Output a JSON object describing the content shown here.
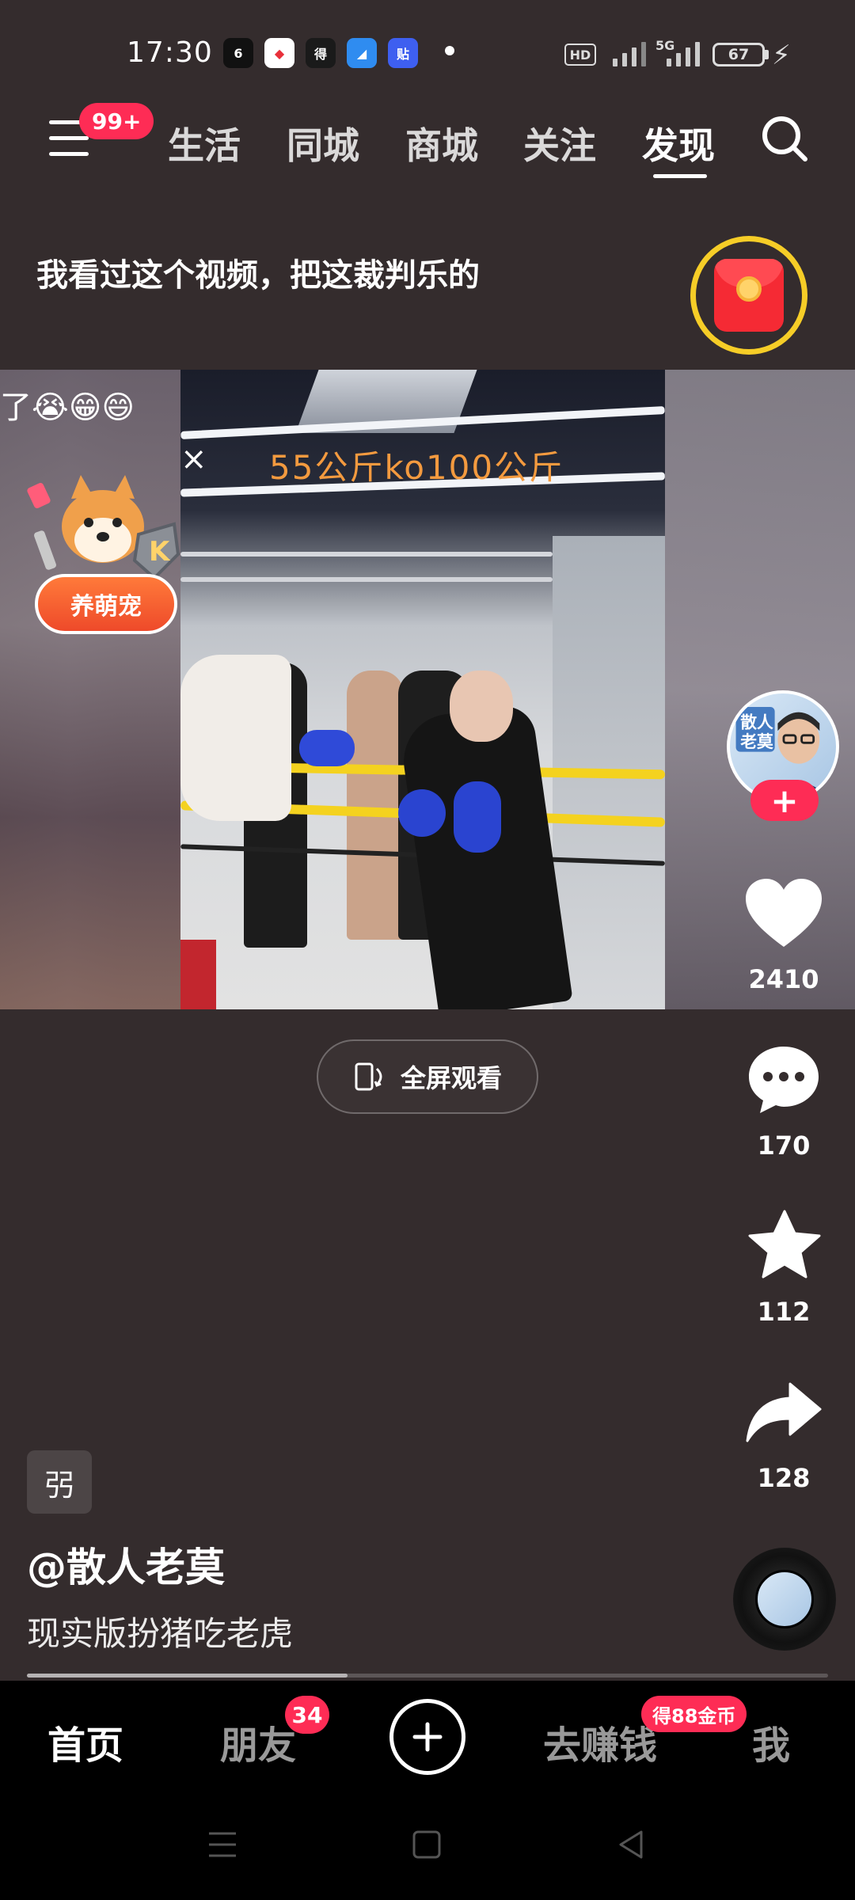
{
  "status_bar": {
    "time": "17:30",
    "app_icons": [
      {
        "name": "tiktok-app-icon",
        "label": "6",
        "bg": "#111111",
        "fg": "#ffffff"
      },
      {
        "name": "map-app-icon",
        "label": "◆",
        "bg": "#ffffff",
        "fg": "#e8303a"
      },
      {
        "name": "news-app-icon",
        "label": "得",
        "bg": "#1a1a1a",
        "fg": "#ffffff"
      },
      {
        "name": "browser-app-icon",
        "label": "◢",
        "bg": "#2f8cf0",
        "fg": "#ffffff"
      },
      {
        "name": "tieba-app-icon",
        "label": "贴",
        "bg": "#3e5ff0",
        "fg": "#ffffff"
      }
    ],
    "hd_label": "HD",
    "network": "5G",
    "battery": "67"
  },
  "top_nav": {
    "menu_badge": "99+",
    "tabs": [
      {
        "label": "生活",
        "active": false
      },
      {
        "label": "同城",
        "active": false
      },
      {
        "label": "商城",
        "active": false
      },
      {
        "label": "关注",
        "active": false
      },
      {
        "label": "发现",
        "active": true
      }
    ]
  },
  "comment_line": "我看过这个视频，把这裁判乐的",
  "video": {
    "overlay_text": "55公斤ko100公斤",
    "emoji_line": "了😭😁😄",
    "pet_button": "养萌宠"
  },
  "rail": {
    "likes": "2410",
    "comments": "170",
    "favorites": "112",
    "shares": "128"
  },
  "fullscreen_label": "全屏观看",
  "caption": {
    "tag": "弜",
    "author": "@散人老莫",
    "description": "现实版扮猪吃老虎",
    "progress": 0.4
  },
  "bottom_nav": {
    "home": "首页",
    "friends": "朋友",
    "friends_badge": "34",
    "earn": "去赚钱",
    "earn_badge": "得88金币",
    "me": "我"
  },
  "colors": {
    "background": "#342c2d",
    "accent": "#fe2c55",
    "overlay_text": "#f39a3f",
    "red_packet_ring": "#f6cd27"
  }
}
